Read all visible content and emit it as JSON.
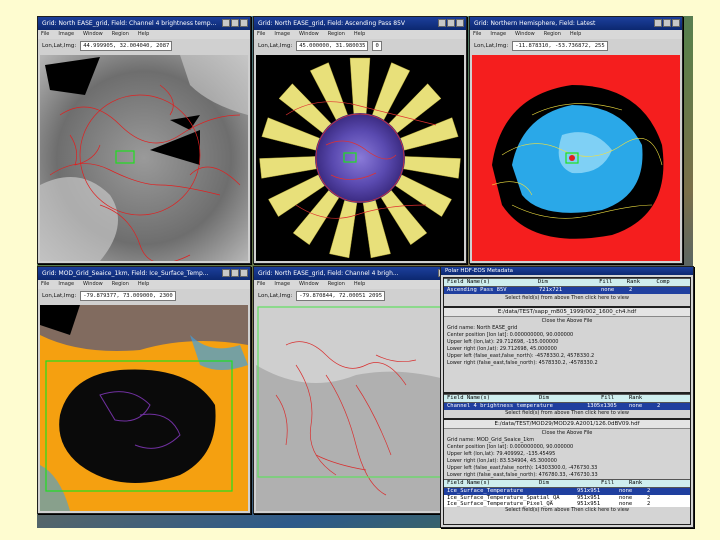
{
  "windows": {
    "w1": {
      "title": "Grid: North EASE_grid, Field: Channel 4 brightness temp...",
      "menu": [
        "File",
        "Image",
        "Window",
        "Region",
        "Help"
      ],
      "label": "Lon,Lat,Img:",
      "lonlat": "44.999905,   32.004040,   2087"
    },
    "w2": {
      "title": "Grid: North EASE_grid, Field: Ascending Pass 85V",
      "menu": [
        "File",
        "Image",
        "Window",
        "Region",
        "Help"
      ],
      "label": "Lon,Lat,Img:",
      "lonlat": "45.000000,   31.980035",
      "value": "0"
    },
    "w3": {
      "title": "Grid: Northern Hemisphere, Field: Latest",
      "menu": [
        "File",
        "Image",
        "Window",
        "Region",
        "Help"
      ],
      "label": "Lon,Lat,Img:",
      "lonlat": "-11.878310,   -53.736872,   255"
    },
    "w4": {
      "title": "Grid: MOD_Grid_Seaice_1km, Field: Ice_Surface_Temp...",
      "menu": [
        "File",
        "Image",
        "Window",
        "Region",
        "Help"
      ],
      "label": "Lon,Lat,Img:",
      "lonlat": "-79.879377,   73.009000,   2300"
    },
    "w5": {
      "title": "Grid: North EASE_grid, Field: Channel 4 brigh...",
      "menu": [
        "File",
        "Image",
        "Window",
        "Region",
        "Help"
      ],
      "label": "Lon,Lat,Img:",
      "lonlat": "-79.870844,   72.00051   2095"
    }
  },
  "metadata": {
    "title": "Polar HDF-EOS Metadata",
    "top_header": [
      "Field Name(s)",
      "Dim",
      "Fill",
      "Rank",
      "Comp"
    ],
    "top_selected": [
      "Ascending Pass 85V",
      "721x721",
      "none",
      "2",
      ""
    ],
    "top_buttons": "Select field(s) from above     Then click here to view",
    "file1_path": "E:/data/TEST/sapp_mB05_1999/002_1600_ch4.hdf",
    "file1_close": "Close the Above File",
    "file1_info": [
      "Grid name: North EASE_grid",
      "Center position [lon lat]: 0.000000000, 90.000000",
      "Upper left (lon,lat): 29.712698, -135.000000",
      "Lower right (lon,lat): 29.712698, 45.000000",
      "Upper left (false_east,false_north): -4578330.2, 4578330.2",
      "Lower right (false_east,false_north): 4578330.2, -4578330.2"
    ],
    "mid_header": [
      "Field Name(s)",
      "Dim",
      "Fill",
      "Rank"
    ],
    "mid_selected": [
      "Channel 4 brightness temperature",
      "1305x1305",
      "none",
      "2"
    ],
    "mid_buttons": "Select field(s) from above     Then click here to view",
    "file2_path": "E:/data/TEST/MOD29/MOD29.A2001/126.0dBV09.hdf",
    "file2_close": "Close the Above File",
    "file2_info": [
      "Grid name: MOD_Grid_Seaice_1km",
      "Center position [lon lat]: 0.000000000, 90.000000",
      "Upper left (lon,lat): 79.409992, -135.45495",
      "Lower right (lon,lat): 83.534904, 45.300000",
      "Upper left (false_east,false_north): 14303300.0, -476730.33",
      "Lower right (false_east,false_north): 476780.33, -476730.33"
    ],
    "bottom_header": [
      "Field Name(s)",
      "Dim",
      "Fill",
      "Rank"
    ],
    "bottom_rows": [
      {
        "cells": [
          "Ice_Surface_Temperature",
          "951x951",
          "none",
          "2"
        ],
        "selected": true
      },
      {
        "cells": [
          "Ice_Surface_Temperature_Spatial_QA",
          "951x951",
          "none",
          "2"
        ],
        "selected": false
      },
      {
        "cells": [
          "Ice_Surface_Temperature_Pixel_QA",
          "951x951",
          "none",
          "2"
        ],
        "selected": false
      }
    ],
    "bottom_buttons": "Select field(s) from above     Then click here to view"
  }
}
